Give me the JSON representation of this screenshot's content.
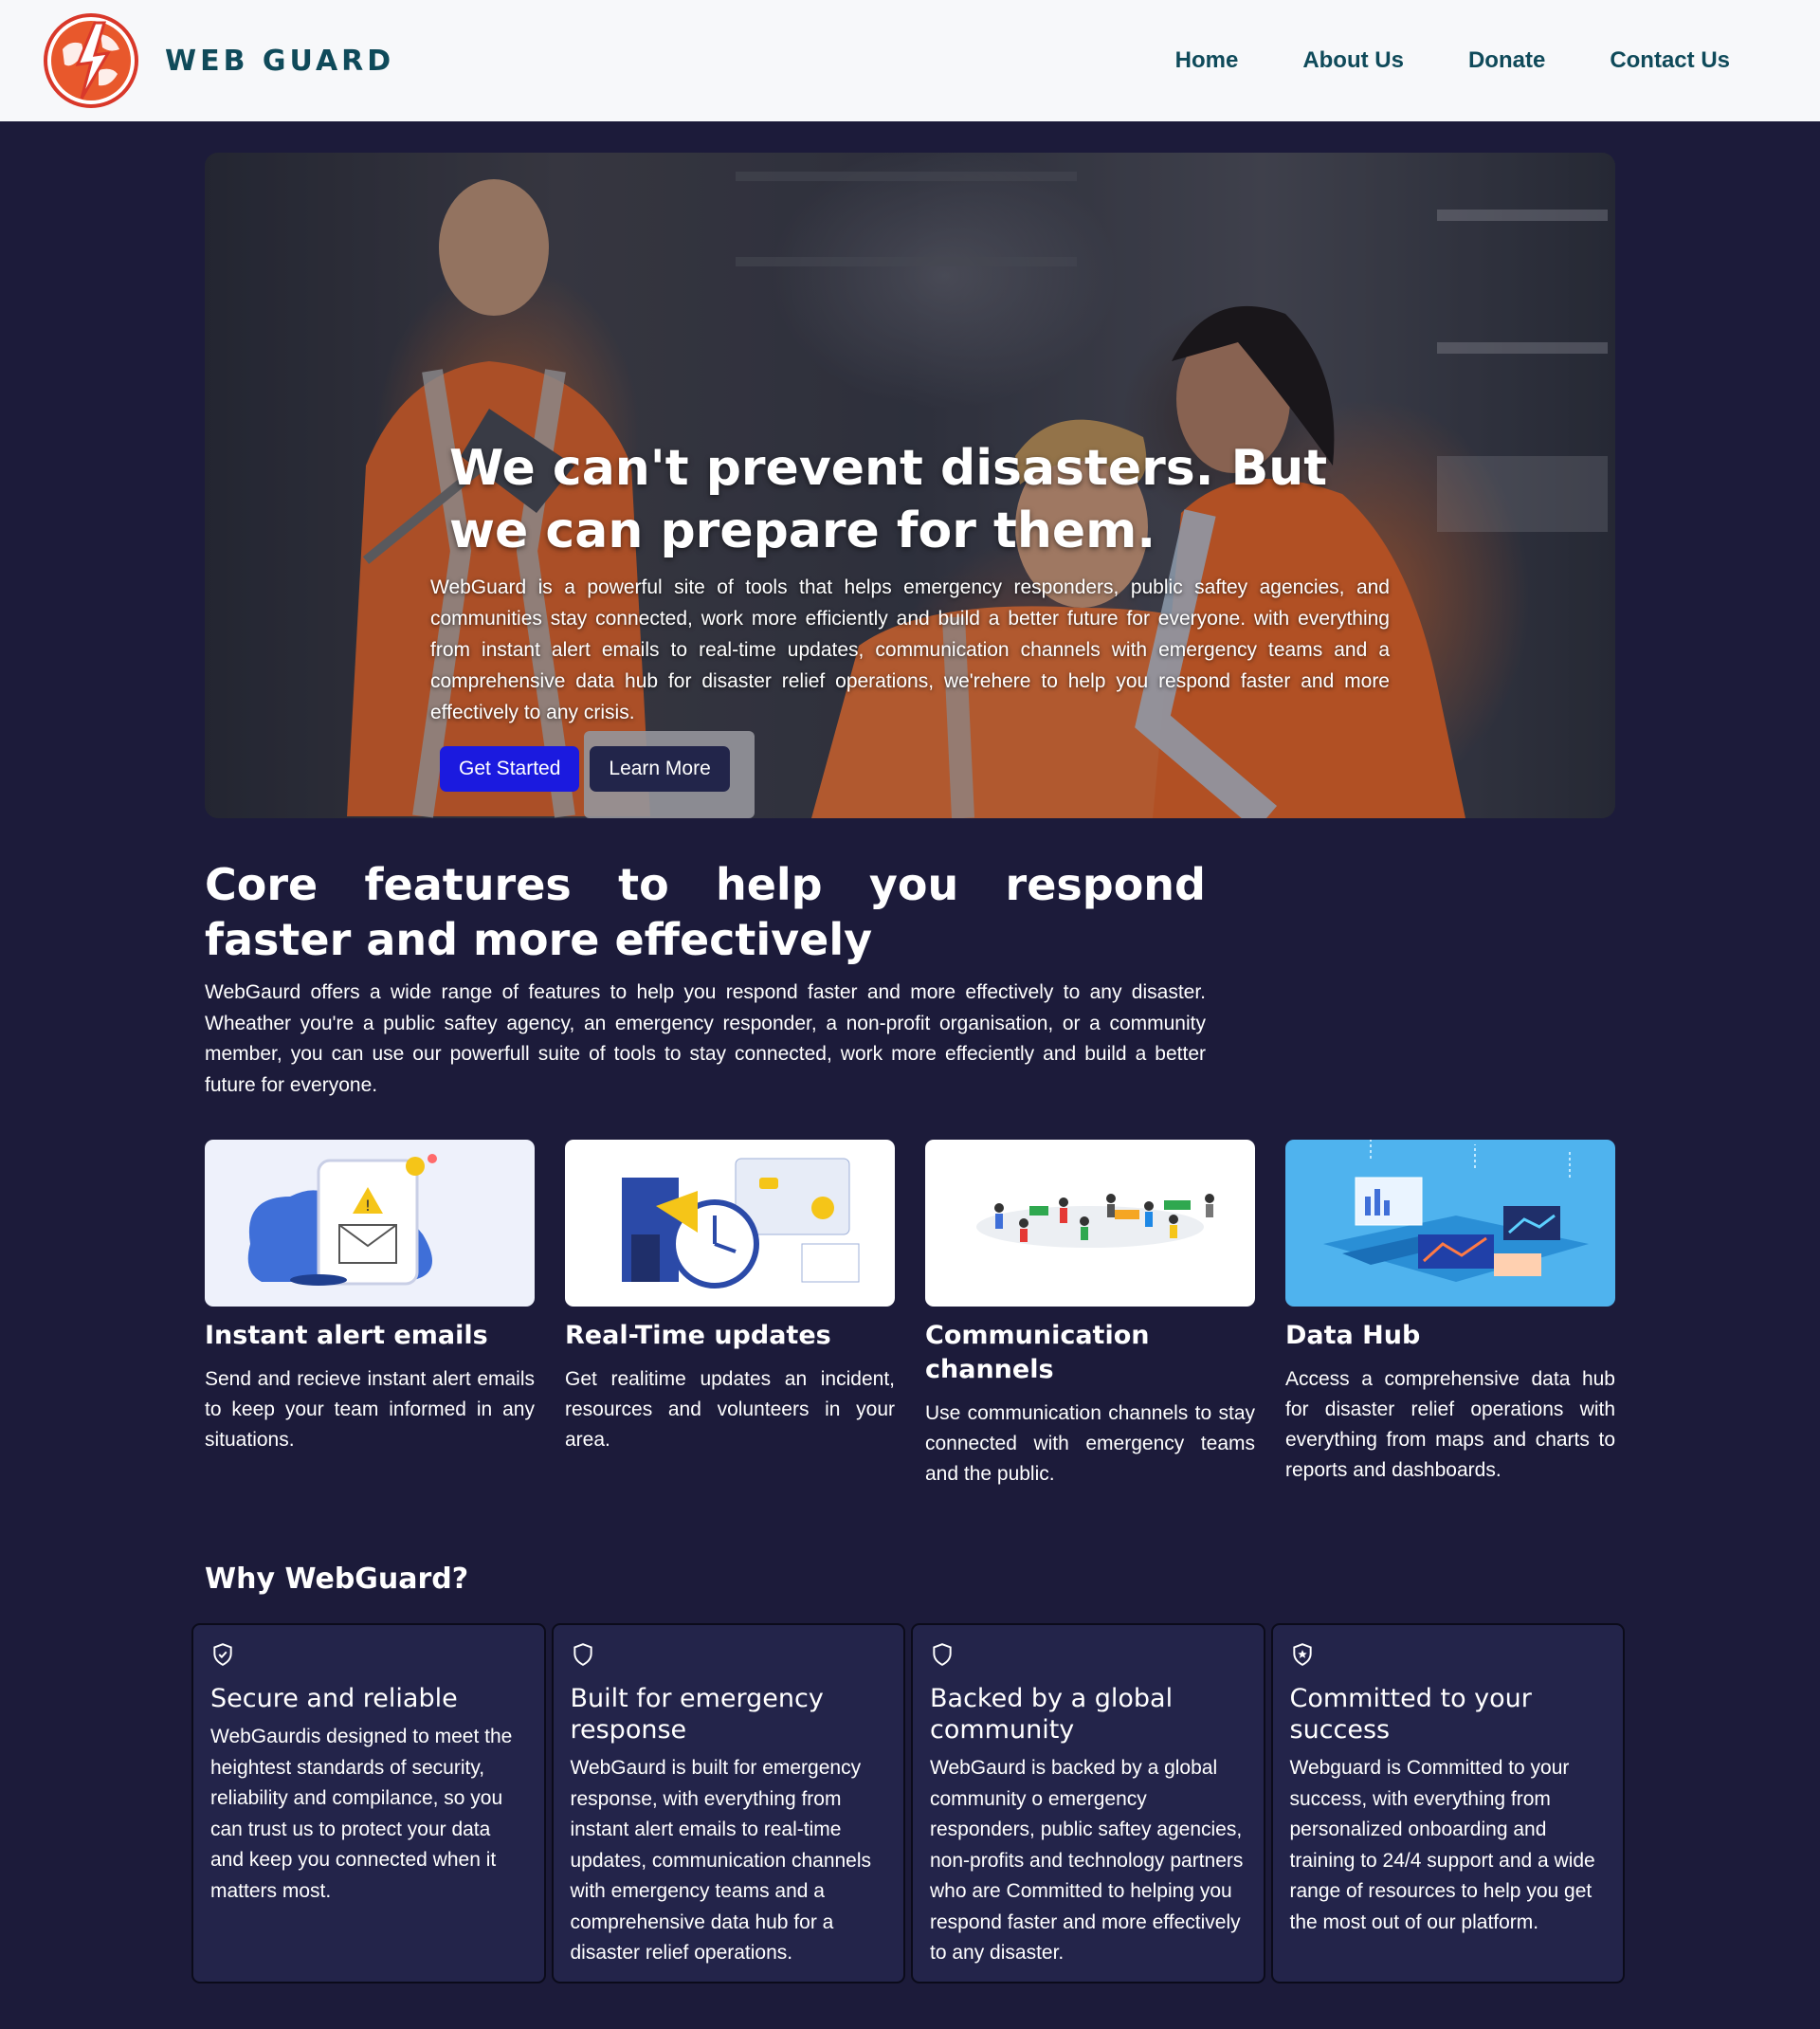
{
  "header": {
    "brand": "WEB GUARD",
    "nav": [
      "Home",
      "About Us",
      "Donate",
      "Contact Us"
    ],
    "logo_icon": "globe-lightning-logo"
  },
  "hero": {
    "title": "We can't prevent disasters. But we can prepare for them.",
    "description": "WebGuard is a powerful site of tools that helps emergency responders, public saftey agencies, and communities stay connected, work more efficiently and build a better future for everyone. with everything from instant alert emails to real-time updates, communication channels with emergency teams and a comprehensive data hub for disaster relief operations, we'rehere to help you respond faster and more effectively to any crisis.",
    "primary_button": "Get Started",
    "secondary_button": "Learn More",
    "primary_color": "#1b1adf"
  },
  "core": {
    "title": "Core features to help you respond faster and more effectively",
    "description": "WebGaurd offers a wide range of features to help you respond faster and more effectively to any disaster. Wheather you're a public saftey agency, an emergency responder, a non-profit organisation, or a community member, you can use our powerfull suite of tools to stay connected, work more effeciently and build a better future for everyone."
  },
  "features": [
    {
      "title": "Instant alert emails",
      "description": "Send and recieve instant alert emails to keep your team informed in any situations.",
      "image": "alert-email-illustration"
    },
    {
      "title": "Real-Time updates",
      "description": "Get realitime updates an incident, resources and volunteers in your area.",
      "image": "realtime-updates-illustration"
    },
    {
      "title": "Communication channels",
      "description": "Use communication channels to stay connected with emergency teams and the public.",
      "image": "communication-network-illustration"
    },
    {
      "title": "Data Hub",
      "description": "Access a comprehensive data hub for disaster relief operations with everything from maps and charts to reports and dashboards.",
      "image": "data-hub-illustration"
    }
  ],
  "why": {
    "title": "Why WebGuard?",
    "cards": [
      {
        "title": "Secure and reliable",
        "body": "WebGaurdis designed to meet the heightest standards of security, reliability and compilance, so you can trust us to protect your data and keep you connected when it matters most.",
        "icon": "shield-check-icon"
      },
      {
        "title": "Built for emergency response",
        "body": "WebGaurd is built for emergency response, with everything from instant alert emails to real-time updates, communication channels with emergency teams and a comprehensive data hub for a disaster relief operations.",
        "icon": "shield-icon"
      },
      {
        "title": "Backed by a global community",
        "body": "WebGaurd is backed by a global community o emergency responders, public saftey agencies, non-profits and technology partners who are Committed to helping you respond faster and more effectively to any disaster.",
        "icon": "shield-icon"
      },
      {
        "title": "Committed to your success",
        "body": "Webguard is Committed to your success, with everything from personalized onboarding and training to 24/4 support and a wide range of resources to help you get the most out of our platform.",
        "icon": "shield-star-icon"
      }
    ]
  }
}
